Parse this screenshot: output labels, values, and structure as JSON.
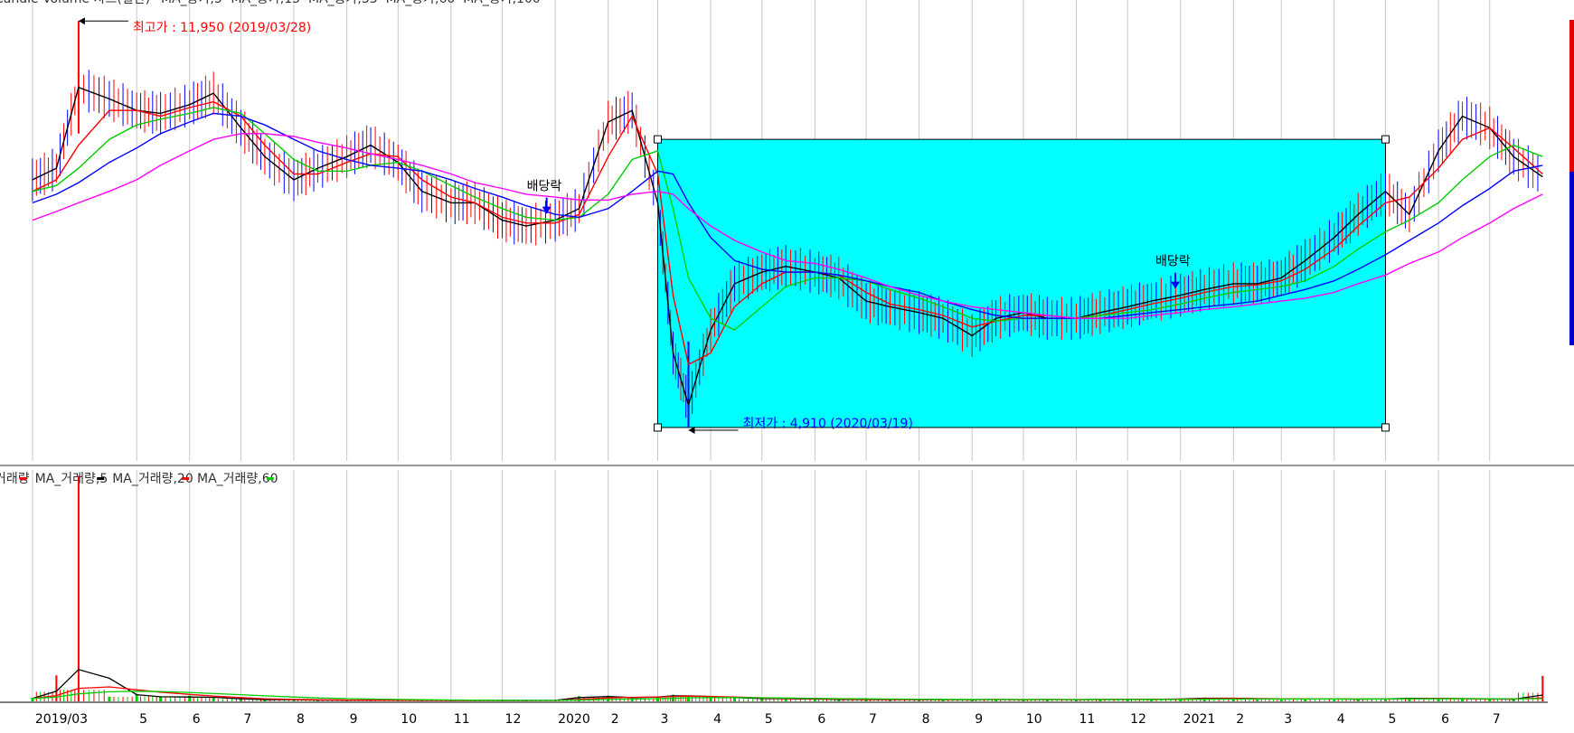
{
  "price_panel": {
    "legend_items": [
      {
        "label": "Candle Volume 차트(일간)",
        "color": "#ff0000"
      },
      {
        "label": "MA_종가,5",
        "color": "#000000"
      },
      {
        "label": "MA_종가,15",
        "color": "#ff0000"
      },
      {
        "label": "MA_종가,33",
        "color": "#00cc00"
      },
      {
        "label": "MA_종가,60",
        "color": "#0000ff"
      },
      {
        "label": "MA_종가,100",
        "color": "#ff00ff"
      }
    ],
    "high_label": "최고가 : 11,950 (2019/03/28)",
    "low_label": "최저가 : 4,910 (2020/03/19)",
    "dividend_label": "배당락",
    "highlight_color": "#00ffff"
  },
  "volume_panel": {
    "legend_items": [
      {
        "label": "거래량",
        "color": "#ff0000"
      },
      {
        "label": "MA_거래량,5",
        "color": "#000000"
      },
      {
        "label": "MA_거래량,20",
        "color": "#ff0000"
      },
      {
        "label": "MA_거래량,60",
        "color": "#00cc00"
      }
    ]
  },
  "x_axis": {
    "ticks": [
      "2019/03",
      "5",
      "6",
      "7",
      "8",
      "9",
      "10",
      "11",
      "12",
      "2020",
      "2",
      "3",
      "4",
      "5",
      "6",
      "7",
      "8",
      "9",
      "10",
      "11",
      "12",
      "2021",
      "2",
      "3",
      "4",
      "5",
      "6",
      "7"
    ]
  },
  "chart_data": {
    "type": "line",
    "title": "",
    "x": [
      "2019/03/01",
      "2019/03/15",
      "2019/03/28",
      "2019/04/15",
      "2019/05/01",
      "2019/05/15",
      "2019/06/01",
      "2019/06/15",
      "2019/07/01",
      "2019/07/15",
      "2019/08/01",
      "2019/08/15",
      "2019/09/01",
      "2019/09/15",
      "2019/10/01",
      "2019/10/15",
      "2019/11/01",
      "2019/11/15",
      "2019/12/01",
      "2019/12/15",
      "2020/01/01",
      "2020/01/15",
      "2020/02/01",
      "2020/02/15",
      "2020/03/01",
      "2020/03/10",
      "2020/03/19",
      "2020/04/01",
      "2020/04/15",
      "2020/05/01",
      "2020/05/15",
      "2020/06/01",
      "2020/06/15",
      "2020/07/01",
      "2020/07/15",
      "2020/08/01",
      "2020/08/15",
      "2020/09/01",
      "2020/09/15",
      "2020/10/01",
      "2020/10/15",
      "2020/11/01",
      "2020/11/15",
      "2020/12/01",
      "2020/12/15",
      "2021/01/01",
      "2021/01/15",
      "2021/02/01",
      "2021/02/15",
      "2021/03/01",
      "2021/03/15",
      "2021/04/01",
      "2021/04/15",
      "2021/05/01",
      "2021/05/15",
      "2021/06/01",
      "2021/06/15",
      "2021/07/01",
      "2021/07/15",
      "2021/08/01"
    ],
    "series": [
      {
        "name": "MA_종가,5",
        "values": [
          9200,
          9400,
          10800,
          10600,
          10400,
          10350,
          10500,
          10700,
          10100,
          9600,
          9200,
          9400,
          9600,
          9800,
          9500,
          9000,
          8800,
          8800,
          8500,
          8400,
          8500,
          8700,
          10200,
          10400,
          8800,
          6200,
          5300,
          6600,
          7400,
          7600,
          7700,
          7600,
          7500,
          7100,
          7000,
          6900,
          6800,
          6500,
          6800,
          6900,
          6800,
          6800,
          6900,
          7000,
          7100,
          7200,
          7300,
          7400,
          7400,
          7500,
          7800,
          8200,
          8600,
          9000,
          8600,
          9700,
          10300,
          10100,
          9600,
          9250
        ]
      },
      {
        "name": "MA_종가,15",
        "values": [
          9000,
          9200,
          9800,
          10400,
          10400,
          10300,
          10450,
          10550,
          10300,
          9800,
          9300,
          9300,
          9500,
          9650,
          9600,
          9200,
          8900,
          8800,
          8550,
          8450,
          8450,
          8600,
          9600,
          10300,
          9300,
          7200,
          6000,
          6200,
          7000,
          7400,
          7600,
          7600,
          7550,
          7250,
          7050,
          6950,
          6850,
          6650,
          6750,
          6850,
          6850,
          6800,
          6850,
          6950,
          7050,
          7150,
          7250,
          7350,
          7380,
          7450,
          7650,
          8000,
          8400,
          8800,
          8900,
          9400,
          9900,
          10100,
          9750,
          9300
        ]
      },
      {
        "name": "MA_종가,33",
        "values": [
          9000,
          9100,
          9400,
          9900,
          10150,
          10250,
          10350,
          10450,
          10350,
          10000,
          9550,
          9350,
          9350,
          9450,
          9500,
          9350,
          9100,
          8900,
          8700,
          8550,
          8500,
          8550,
          8950,
          9550,
          9700,
          8700,
          7500,
          6800,
          6600,
          7000,
          7350,
          7500,
          7500,
          7450,
          7300,
          7150,
          7000,
          6800,
          6750,
          6800,
          6800,
          6800,
          6850,
          6900,
          6950,
          7050,
          7150,
          7250,
          7300,
          7350,
          7450,
          7700,
          8000,
          8300,
          8500,
          8800,
          9200,
          9600,
          9800,
          9600
        ]
      },
      {
        "name": "MA_종가,60",
        "values": [
          8800,
          8950,
          9150,
          9500,
          9750,
          10000,
          10200,
          10350,
          10300,
          10150,
          9900,
          9700,
          9550,
          9450,
          9400,
          9350,
          9200,
          9050,
          8900,
          8750,
          8600,
          8550,
          8700,
          9000,
          9350,
          9300,
          8800,
          8200,
          7800,
          7650,
          7600,
          7600,
          7550,
          7450,
          7350,
          7250,
          7100,
          6950,
          6850,
          6800,
          6800,
          6800,
          6800,
          6850,
          6900,
          6950,
          7000,
          7050,
          7100,
          7200,
          7300,
          7450,
          7650,
          7900,
          8150,
          8450,
          8750,
          9050,
          9350,
          9450
        ]
      },
      {
        "name": "MA_종가,100",
        "values": [
          8500,
          8650,
          8800,
          9000,
          9200,
          9450,
          9700,
          9900,
          10000,
          10000,
          9950,
          9850,
          9750,
          9650,
          9550,
          9450,
          9300,
          9150,
          9050,
          8950,
          8900,
          8850,
          8850,
          8950,
          9000,
          8950,
          8700,
          8400,
          8150,
          7950,
          7800,
          7750,
          7650,
          7500,
          7350,
          7200,
          7100,
          7000,
          6950,
          6900,
          6850,
          6800,
          6800,
          6800,
          6850,
          6900,
          6950,
          7000,
          7050,
          7100,
          7150,
          7250,
          7400,
          7550,
          7750,
          7950,
          8200,
          8450,
          8700,
          8950
        ]
      }
    ],
    "volume_series": [
      {
        "name": "거래량",
        "values": [
          120,
          900,
          7800,
          160,
          260,
          150,
          200,
          140,
          80,
          60,
          70,
          40,
          40,
          40,
          30,
          30,
          30,
          30,
          30,
          30,
          40,
          180,
          200,
          120,
          160,
          230,
          200,
          190,
          120,
          90,
          90,
          80,
          70,
          60,
          60,
          60,
          60,
          60,
          70,
          60,
          70,
          60,
          70,
          70,
          70,
          90,
          130,
          110,
          90,
          90,
          80,
          80,
          70,
          90,
          120,
          110,
          90,
          80,
          70,
          880
        ]
      },
      {
        "name": "MA_거래량,5",
        "values": [
          100,
          350,
          1100,
          800,
          230,
          160,
          150,
          140,
          90,
          60,
          60,
          45,
          40,
          40,
          35,
          30,
          30,
          30,
          30,
          30,
          35,
          130,
          170,
          130,
          150,
          190,
          190,
          170,
          130,
          100,
          90,
          80,
          70,
          60,
          60,
          60,
          60,
          60,
          65,
          60,
          65,
          60,
          65,
          70,
          70,
          80,
          110,
          110,
          95,
          90,
          80,
          80,
          75,
          85,
          105,
          105,
          95,
          85,
          75,
          220
        ]
      },
      {
        "name": "MA_거래량,20",
        "values": [
          100,
          200,
          450,
          500,
          400,
          320,
          240,
          180,
          130,
          90,
          70,
          55,
          45,
          40,
          38,
          35,
          32,
          30,
          30,
          30,
          32,
          70,
          120,
          140,
          150,
          170,
          180,
          170,
          150,
          120,
          100,
          90,
          80,
          70,
          65,
          62,
          60,
          60,
          62,
          62,
          63,
          62,
          63,
          65,
          66,
          72,
          90,
          100,
          95,
          90,
          85,
          82,
          80,
          82,
          95,
          100,
          95,
          90,
          82,
          120
        ]
      },
      {
        "name": "MA_거래량,60",
        "values": [
          100,
          150,
          260,
          330,
          350,
          340,
          310,
          270,
          230,
          190,
          150,
          120,
          95,
          80,
          65,
          55,
          48,
          42,
          38,
          35,
          33,
          45,
          65,
          80,
          95,
          110,
          125,
          130,
          130,
          125,
          115,
          105,
          95,
          88,
          80,
          74,
          70,
          66,
          64,
          63,
          63,
          62,
          62,
          63,
          64,
          66,
          72,
          78,
          82,
          84,
          84,
          84,
          83,
          84,
          88,
          92,
          93,
          92,
          90,
          95
        ]
      }
    ],
    "markers": [
      {
        "type": "high",
        "date": "2019/03/28",
        "value": 11950,
        "label": "최고가 : 11,950 (2019/03/28)"
      },
      {
        "type": "low",
        "date": "2020/03/19",
        "value": 4910,
        "label": "최저가 : 4,910 (2020/03/19)"
      },
      {
        "type": "dividend",
        "date": "2019/12/27",
        "label": "배당락"
      },
      {
        "type": "dividend",
        "date": "2020/12/29",
        "label": "배당락"
      }
    ],
    "highlight_range": {
      "x_start": "2020/03/01",
      "x_end": "2021/05/01",
      "y_start": 4910,
      "y_end": 9900
    },
    "ylim": [
      4800,
      12000
    ],
    "volume_ylim": [
      0,
      8000
    ],
    "grid": true,
    "xlabel": "",
    "ylabel": ""
  }
}
